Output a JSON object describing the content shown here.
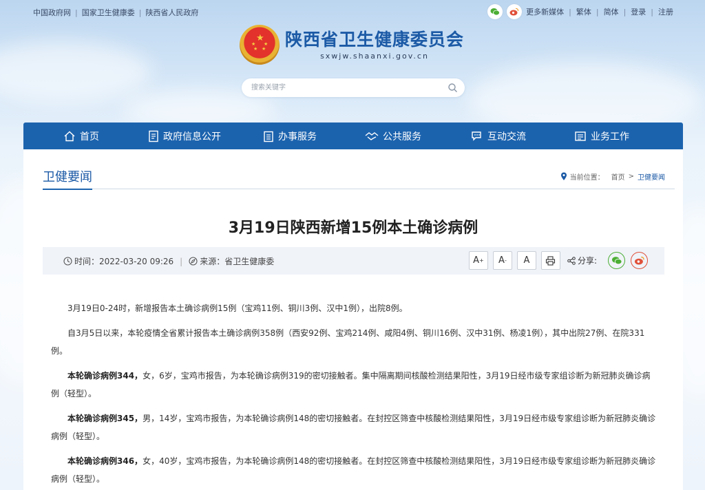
{
  "topbar": {
    "links": [
      "中国政府网",
      "国家卫生健康委",
      "陕西省人民政府"
    ],
    "more_media": "更多新媒体",
    "traditional": "繁体",
    "simplified": "简体",
    "login": "登录",
    "register": "注册"
  },
  "header": {
    "site_name": "陕西省卫生健康委员会",
    "domain": "sxwjw.shaanxi.gov.cn"
  },
  "search": {
    "placeholder": "搜索关键字"
  },
  "nav": {
    "items": [
      {
        "label": "首页",
        "icon": "home-icon"
      },
      {
        "label": "政府信息公开",
        "icon": "document-icon"
      },
      {
        "label": "办事服务",
        "icon": "clipboard-icon"
      },
      {
        "label": "公共服务",
        "icon": "handshake-icon"
      },
      {
        "label": "互动交流",
        "icon": "chat-icon"
      },
      {
        "label": "业务工作",
        "icon": "briefcase-icon"
      }
    ]
  },
  "section": {
    "title": "卫健要闻",
    "breadcrumb": {
      "prefix": "当前位置：",
      "home": "首页",
      "current": "卫健要闻"
    }
  },
  "article": {
    "title": "3月19日陕西新增15例本土确诊病例",
    "time_label": "时间：",
    "time": "2022-03-20 09:26",
    "source_label": "来源：",
    "source": "省卫生健康委",
    "share_label": "分享:",
    "font_buttons": [
      "A",
      "A",
      "A"
    ],
    "p1": "3月19日0-24时，新增报告本土确诊病例15例（宝鸡11例、铜川3例、汉中1例），出院8例。",
    "p2": "自3月5日以来，本轮疫情全省累计报告本土确诊病例358例（西安92例、宝鸡214例、咸阳4例、铜川16例、汉中31例、杨凌1例），其中出院27例、在院331例。",
    "cases": [
      {
        "head": "本轮确诊病例344，",
        "text": "女，6岁，宝鸡市报告，为本轮确诊病例319的密切接触者。集中隔离期间核酸检测结果阳性，3月19日经市级专家组诊断为新冠肺炎确诊病例（轻型）。"
      },
      {
        "head": "本轮确诊病例345，",
        "text": "男，14岁，宝鸡市报告，为本轮确诊病例148的密切接触者。在封控区筛查中核酸检测结果阳性，3月19日经市级专家组诊断为新冠肺炎确诊病例（轻型）。"
      },
      {
        "head": "本轮确诊病例346，",
        "text": "女，40岁，宝鸡市报告，为本轮确诊病例148的密切接触者。在封控区筛查中核酸检测结果阳性，3月19日经市级专家组诊断为新冠肺炎确诊病例（轻型）。"
      }
    ]
  },
  "colors": {
    "primary": "#1c63ae",
    "title_blue": "#1c5aa6",
    "wechat": "#4cae35",
    "weibo": "#e0503a"
  }
}
